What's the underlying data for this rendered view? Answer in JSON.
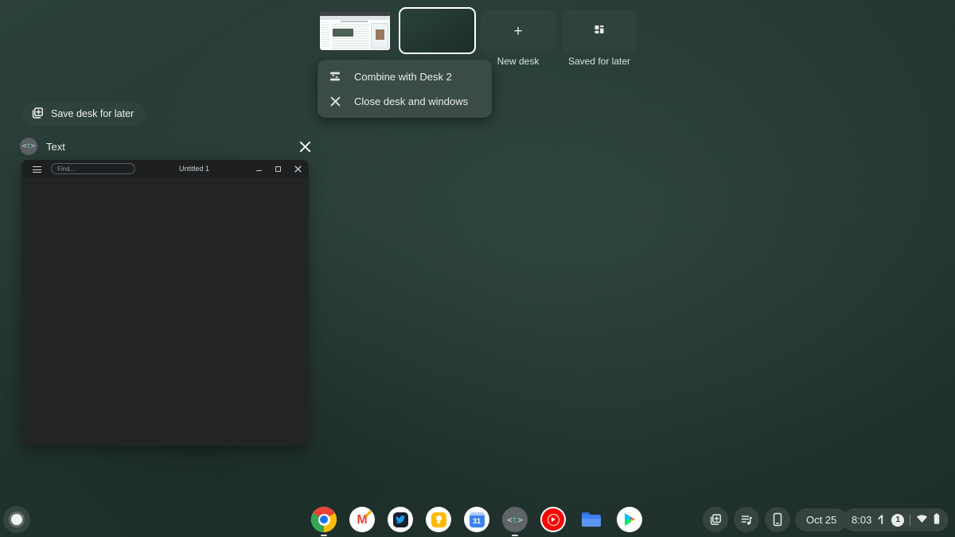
{
  "desk_bar": {
    "new_desk": {
      "label": "New desk",
      "icon": "plus-icon",
      "plus_glyph": "+"
    },
    "saved_for_later": {
      "label": "Saved for later",
      "icon": "desks-grid-icon"
    },
    "desks": [
      {
        "name": "desk-1",
        "content": "browser window with wikipedia-style article",
        "active": false
      },
      {
        "name": "desk-2",
        "content": "empty wallpaper",
        "active": true
      }
    ]
  },
  "context_menu": {
    "items": [
      {
        "label": "Combine with Desk 2",
        "icon": "combine-desks-icon"
      },
      {
        "label": "Close desk and windows",
        "icon": "close-icon"
      }
    ]
  },
  "desk_actions": {
    "save_desk_label": "Save desk for later",
    "icon": "save-desk-icon"
  },
  "window_preview": {
    "app_name": "Text",
    "app_icon": {
      "open": "<",
      "letter": "t",
      "close": ">"
    },
    "close_icon": "close-icon",
    "titlebar": {
      "find_placeholder": "Find...",
      "title": "Untitled 1"
    }
  },
  "shelf": {
    "launcher": "launcher-button",
    "apps": [
      {
        "id": "chrome",
        "running": true
      },
      {
        "id": "gmail",
        "running": false
      },
      {
        "id": "twitter",
        "running": false
      },
      {
        "id": "keep",
        "running": false
      },
      {
        "id": "calendar",
        "running": false,
        "day": "31"
      },
      {
        "id": "text",
        "running": true,
        "glyph": {
          "open": "<",
          "letter": "t",
          "close": ">"
        }
      },
      {
        "id": "youtube-music",
        "running": false
      },
      {
        "id": "files",
        "running": false
      },
      {
        "id": "play-store",
        "running": false
      }
    ]
  },
  "status_area": {
    "buttons": [
      "save-desk-icon",
      "media-controls-icon",
      "phone-hub-icon"
    ],
    "date": "Oct 25",
    "time": "8:03",
    "notification_count": "1",
    "icons": [
      "up-arrow-icon",
      "wifi-icon",
      "battery-icon"
    ]
  },
  "colors": {
    "wallpaper": "#253833",
    "surface": "#35443f",
    "menu": "#3b4b46",
    "window_titlebar": "#1d1f20",
    "window_body": "#222426",
    "accent_text_green": "#41c780",
    "active_desk_border": "#ffffff"
  }
}
